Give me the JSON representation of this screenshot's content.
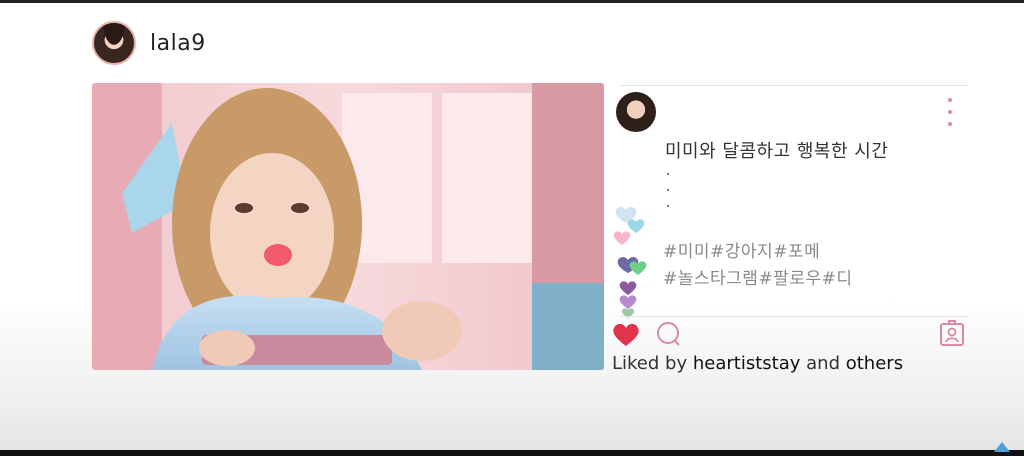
{
  "post": {
    "username": "lala9",
    "caption": "미미와 달콤하고 행복한 시간",
    "ellipsis": [
      "·",
      "·",
      "·"
    ],
    "hashtags": [
      "#미미#강아지#포메",
      "#놀스타그램#팔로우#디"
    ],
    "liked_prefix": "Liked by",
    "liked_user": "heartiststay",
    "liked_and": "and",
    "liked_others": "others"
  },
  "icons": {
    "like": "heart-icon",
    "comment": "comment-bubble-icon",
    "save": "profile-bookmark-icon",
    "more": "more-vertical-icon"
  },
  "colors": {
    "accent_pink": "#d98aa0",
    "like_red": "#e0344e"
  }
}
